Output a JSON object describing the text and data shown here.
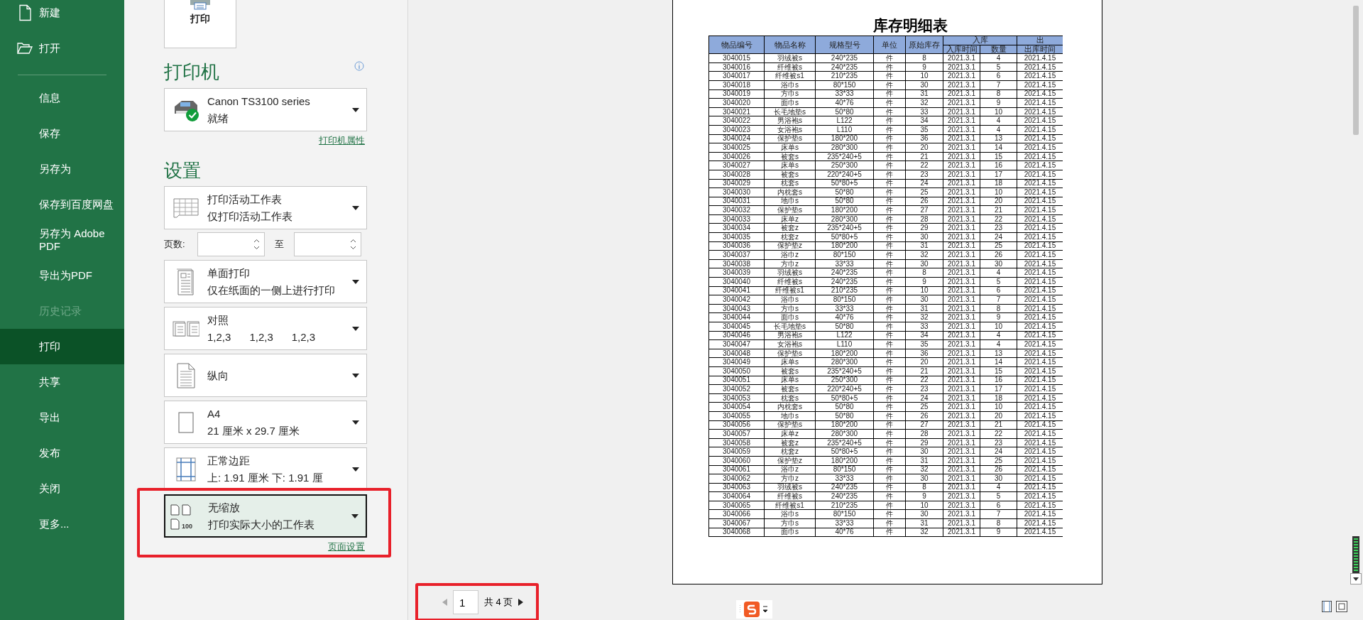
{
  "sidebar": {
    "top_items": [
      {
        "label": "新建"
      },
      {
        "label": "打开"
      }
    ],
    "items": [
      {
        "label": "信息",
        "selected": false,
        "disabled": false
      },
      {
        "label": "保存",
        "selected": false,
        "disabled": false
      },
      {
        "label": "另存为",
        "selected": false,
        "disabled": false
      },
      {
        "label": "保存到百度网盘",
        "selected": false,
        "disabled": false
      },
      {
        "label": "另存为 Adobe PDF",
        "selected": false,
        "disabled": false
      },
      {
        "label": "导出为PDF",
        "selected": false,
        "disabled": false
      },
      {
        "label": "历史记录",
        "selected": false,
        "disabled": true
      },
      {
        "label": "打印",
        "selected": true,
        "disabled": false
      },
      {
        "label": "共享",
        "selected": false,
        "disabled": false
      },
      {
        "label": "导出",
        "selected": false,
        "disabled": false
      },
      {
        "label": "发布",
        "selected": false,
        "disabled": false
      },
      {
        "label": "关闭",
        "selected": false,
        "disabled": false
      },
      {
        "label": "更多...",
        "selected": false,
        "disabled": false
      }
    ]
  },
  "print_button": {
    "label": "打印"
  },
  "printer": {
    "heading": "打印机",
    "name": "Canon TS3100 series",
    "status": "就绪",
    "ready": true,
    "properties_link": "打印机属性"
  },
  "settings": {
    "heading": "设置",
    "options": [
      {
        "kind": "dropdown",
        "title": "打印活动工作表",
        "subtitle": "仅打印活动工作表",
        "selected": false,
        "highlighted": false
      },
      {
        "kind": "page-range",
        "label": "页数:",
        "separator": "至"
      },
      {
        "kind": "dropdown",
        "title": "单面打印",
        "subtitle": "仅在纸面的一侧上进行打印",
        "selected": false,
        "highlighted": false
      },
      {
        "kind": "dropdown",
        "title": "对照",
        "subtitle_parts": [
          "1,2,3",
          "1,2,3",
          "1,2,3"
        ],
        "selected": false,
        "highlighted": false
      },
      {
        "kind": "dropdown",
        "title": "纵向",
        "selected": false,
        "highlighted": false
      },
      {
        "kind": "dropdown",
        "title": "A4",
        "subtitle": "21 厘米 x 29.7 厘米",
        "selected": false,
        "highlighted": false
      },
      {
        "kind": "dropdown",
        "title": "正常边距",
        "subtitle": "上: 1.91 厘米 下: 1.91 厘",
        "selected": false,
        "highlighted": false
      },
      {
        "kind": "dropdown",
        "icon_text": "100",
        "title": "无缩放",
        "subtitle": "打印实际大小的工作表",
        "selected": true,
        "highlighted": true
      }
    ],
    "page_setup_link": "页面设置"
  },
  "preview": {
    "title": "库存明细表",
    "header": [
      {
        "kind": "single",
        "label": "物品编号"
      },
      {
        "kind": "single",
        "label": "物品名称"
      },
      {
        "kind": "single",
        "label": "规格型号"
      },
      {
        "kind": "single",
        "label": "单位"
      },
      {
        "kind": "single",
        "label": "原始库存"
      },
      {
        "kind": "group",
        "label": "入库",
        "columns": [
          "入库时间",
          "数量"
        ]
      },
      {
        "kind": "group",
        "label": "出",
        "columns": [
          "出库时间"
        ]
      }
    ],
    "rows": [
      [
        "3040015",
        "羽绒被s",
        "240*235",
        "件",
        "8",
        "2021.3.1",
        "4",
        "2021.4.15"
      ],
      [
        "3040016",
        "纤维被s",
        "240*235",
        "件",
        "9",
        "2021.3.1",
        "5",
        "2021.4.15"
      ],
      [
        "3040017",
        "纤维被s1",
        "210*235",
        "件",
        "10",
        "2021.3.1",
        "6",
        "2021.4.15"
      ],
      [
        "3040018",
        "浴巾s",
        "80*150",
        "件",
        "30",
        "2021.3.1",
        "7",
        "2021.4.15"
      ],
      [
        "3040019",
        "方巾s",
        "33*33",
        "件",
        "31",
        "2021.3.1",
        "8",
        "2021.4.15"
      ],
      [
        "3040020",
        "面巾s",
        "40*76",
        "件",
        "32",
        "2021.3.1",
        "9",
        "2021.4.15"
      ],
      [
        "3040021",
        "长毛地垫s",
        "50*80",
        "件",
        "33",
        "2021.3.1",
        "10",
        "2021.4.15"
      ],
      [
        "3040022",
        "男浴袍s",
        "L122",
        "件",
        "34",
        "2021.3.1",
        "4",
        "2021.4.15"
      ],
      [
        "3040023",
        "女浴袍s",
        "L110",
        "件",
        "35",
        "2021.3.1",
        "4",
        "2021.4.15"
      ],
      [
        "3040024",
        "保护垫s",
        "180*200",
        "件",
        "36",
        "2021.3.1",
        "13",
        "2021.4.15"
      ],
      [
        "3040025",
        "床单s",
        "280*300",
        "件",
        "20",
        "2021.3.1",
        "14",
        "2021.4.15"
      ],
      [
        "3040026",
        "被套s",
        "235*240+5",
        "件",
        "21",
        "2021.3.1",
        "15",
        "2021.4.15"
      ],
      [
        "3040027",
        "床单s",
        "250*300",
        "件",
        "22",
        "2021.3.1",
        "16",
        "2021.4.15"
      ],
      [
        "3040028",
        "被套s",
        "220*240+5",
        "件",
        "23",
        "2021.3.1",
        "17",
        "2021.4.15"
      ],
      [
        "3040029",
        "枕套s",
        "50*80+5",
        "件",
        "24",
        "2021.3.1",
        "18",
        "2021.4.15"
      ],
      [
        "3040030",
        "内枕套s",
        "50*80",
        "件",
        "25",
        "2021.3.1",
        "10",
        "2021.4.15"
      ],
      [
        "3040031",
        "地巾s",
        "50*80",
        "件",
        "26",
        "2021.3.1",
        "20",
        "2021.4.15"
      ],
      [
        "3040032",
        "保护垫s",
        "180*200",
        "件",
        "27",
        "2021.3.1",
        "21",
        "2021.4.15"
      ],
      [
        "3040033",
        "床单z",
        "280*300",
        "件",
        "28",
        "2021.3.1",
        "22",
        "2021.4.15"
      ],
      [
        "3040034",
        "被套z",
        "235*240+5",
        "件",
        "29",
        "2021.3.1",
        "23",
        "2021.4.15"
      ],
      [
        "3040035",
        "枕套z",
        "50*80+5",
        "件",
        "30",
        "2021.3.1",
        "24",
        "2021.4.15"
      ],
      [
        "3040036",
        "保护垫z",
        "180*200",
        "件",
        "31",
        "2021.3.1",
        "25",
        "2021.4.15"
      ],
      [
        "3040037",
        "浴巾z",
        "80*150",
        "件",
        "32",
        "2021.3.1",
        "26",
        "2021.4.15"
      ],
      [
        "3040038",
        "方巾z",
        "33*33",
        "件",
        "30",
        "2021.3.1",
        "30",
        "2021.4.15"
      ],
      [
        "3040039",
        "羽绒被s",
        "240*235",
        "件",
        "8",
        "2021.3.1",
        "4",
        "2021.4.15"
      ],
      [
        "3040040",
        "纤维被s",
        "240*235",
        "件",
        "9",
        "2021.3.1",
        "5",
        "2021.4.15"
      ],
      [
        "3040041",
        "纤维被s1",
        "210*235",
        "件",
        "10",
        "2021.3.1",
        "6",
        "2021.4.15"
      ],
      [
        "3040042",
        "浴巾s",
        "80*150",
        "件",
        "30",
        "2021.3.1",
        "7",
        "2021.4.15"
      ],
      [
        "3040043",
        "方巾s",
        "33*33",
        "件",
        "31",
        "2021.3.1",
        "8",
        "2021.4.15"
      ],
      [
        "3040044",
        "面巾s",
        "40*76",
        "件",
        "32",
        "2021.3.1",
        "9",
        "2021.4.15"
      ],
      [
        "3040045",
        "长毛地垫s",
        "50*80",
        "件",
        "33",
        "2021.3.1",
        "10",
        "2021.4.15"
      ],
      [
        "3040046",
        "男浴袍s",
        "L122",
        "件",
        "34",
        "2021.3.1",
        "4",
        "2021.4.15"
      ],
      [
        "3040047",
        "女浴袍s",
        "L110",
        "件",
        "35",
        "2021.3.1",
        "4",
        "2021.4.15"
      ],
      [
        "3040048",
        "保护垫s",
        "180*200",
        "件",
        "36",
        "2021.3.1",
        "13",
        "2021.4.15"
      ],
      [
        "3040049",
        "床单s",
        "280*300",
        "件",
        "20",
        "2021.3.1",
        "14",
        "2021.4.15"
      ],
      [
        "3040050",
        "被套s",
        "235*240+5",
        "件",
        "21",
        "2021.3.1",
        "15",
        "2021.4.15"
      ],
      [
        "3040051",
        "床单s",
        "250*300",
        "件",
        "22",
        "2021.3.1",
        "16",
        "2021.4.15"
      ],
      [
        "3040052",
        "被套s",
        "220*240+5",
        "件",
        "23",
        "2021.3.1",
        "17",
        "2021.4.15"
      ],
      [
        "3040053",
        "枕套s",
        "50*80+5",
        "件",
        "24",
        "2021.3.1",
        "18",
        "2021.4.15"
      ],
      [
        "3040054",
        "内枕套s",
        "50*80",
        "件",
        "25",
        "2021.3.1",
        "10",
        "2021.4.15"
      ],
      [
        "3040055",
        "地巾s",
        "50*80",
        "件",
        "26",
        "2021.3.1",
        "20",
        "2021.4.15"
      ],
      [
        "3040056",
        "保护垫s",
        "180*200",
        "件",
        "27",
        "2021.3.1",
        "21",
        "2021.4.15"
      ],
      [
        "3040057",
        "床单z",
        "280*300",
        "件",
        "28",
        "2021.3.1",
        "22",
        "2021.4.15"
      ],
      [
        "3040058",
        "被套z",
        "235*240+5",
        "件",
        "29",
        "2021.3.1",
        "23",
        "2021.4.15"
      ],
      [
        "3040059",
        "枕套z",
        "50*80+5",
        "件",
        "30",
        "2021.3.1",
        "24",
        "2021.4.15"
      ],
      [
        "3040060",
        "保护垫z",
        "180*200",
        "件",
        "31",
        "2021.3.1",
        "25",
        "2021.4.15"
      ],
      [
        "3040061",
        "浴巾z",
        "80*150",
        "件",
        "32",
        "2021.3.1",
        "26",
        "2021.4.15"
      ],
      [
        "3040062",
        "方巾z",
        "33*33",
        "件",
        "30",
        "2021.3.1",
        "30",
        "2021.4.15"
      ],
      [
        "3040063",
        "羽绒被s",
        "240*235",
        "件",
        "8",
        "2021.3.1",
        "4",
        "2021.4.15"
      ],
      [
        "3040064",
        "纤维被s",
        "240*235",
        "件",
        "9",
        "2021.3.1",
        "5",
        "2021.4.15"
      ],
      [
        "3040065",
        "纤维被s1",
        "210*235",
        "件",
        "10",
        "2021.3.1",
        "6",
        "2021.4.15"
      ],
      [
        "3040066",
        "浴巾s",
        "80*150",
        "件",
        "30",
        "2021.3.1",
        "7",
        "2021.4.15"
      ],
      [
        "3040067",
        "方巾s",
        "33*33",
        "件",
        "31",
        "2021.3.1",
        "8",
        "2021.4.15"
      ],
      [
        "3040068",
        "面巾s",
        "40*76",
        "件",
        "32",
        "2021.3.1",
        "9",
        "2021.4.15"
      ]
    ]
  },
  "pager": {
    "page": "1",
    "total": "共 4 页",
    "highlighted": true
  }
}
